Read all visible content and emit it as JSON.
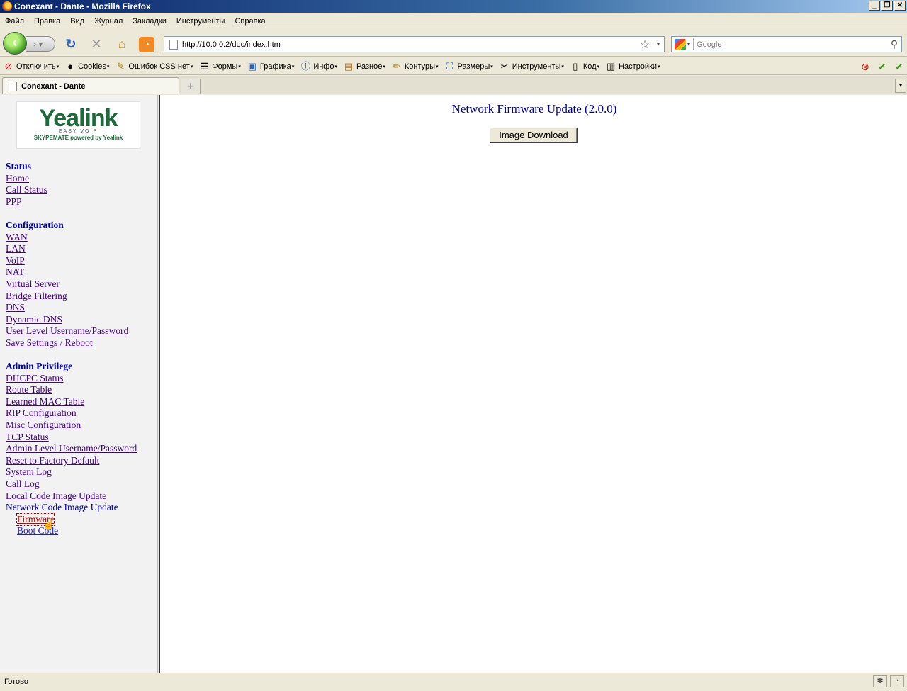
{
  "window": {
    "title": "Conexant - Dante - Mozilla Firefox",
    "buttons": [
      "_",
      "❐",
      "✕"
    ]
  },
  "menu": [
    "Файл",
    "Правка",
    "Вид",
    "Журнал",
    "Закладки",
    "Инструменты",
    "Справка"
  ],
  "navigation": {
    "url": "http://10.0.0.2/doc/index.htm",
    "search_placeholder": "Google"
  },
  "devtoolbar": {
    "items": [
      {
        "icon": "disable-icon",
        "label": "Отключить"
      },
      {
        "icon": "cookies-icon",
        "label": "Cookies"
      },
      {
        "icon": "css-icon",
        "label": "Ошибок CSS нет"
      },
      {
        "icon": "forms-icon",
        "label": "Формы"
      },
      {
        "icon": "images-icon",
        "label": "Графика"
      },
      {
        "icon": "info-icon",
        "label": "Инфо"
      },
      {
        "icon": "misc-icon",
        "label": "Разное"
      },
      {
        "icon": "outline-icon",
        "label": "Контуры"
      },
      {
        "icon": "resize-icon",
        "label": "Размеры"
      },
      {
        "icon": "tools-icon",
        "label": "Инструменты"
      },
      {
        "icon": "source-icon",
        "label": "Код"
      },
      {
        "icon": "options-icon",
        "label": "Настройки"
      }
    ]
  },
  "tabs": [
    {
      "title": "Conexant - Dante",
      "active": true
    }
  ],
  "sidebar": {
    "logo": {
      "wordmark": "Yealink",
      "subtitle": "EASY VOIP",
      "tagline": "SKYPEMATE powered by Yealink"
    },
    "status_heading": "Status",
    "status_links": [
      "Home",
      "Call Status",
      "PPP"
    ],
    "config_heading": "Configuration",
    "config_links": [
      "WAN",
      "LAN",
      "VoIP",
      "NAT",
      "Virtual Server",
      "Bridge Filtering",
      "DNS",
      "Dynamic DNS",
      "User Level Username/Password",
      "Save Settings / Reboot"
    ],
    "admin_heading": "Admin Privilege",
    "admin_links": [
      "DHCPC Status",
      "Route Table",
      "Learned MAC Table",
      "RIP Configuration",
      "Misc Configuration",
      "TCP Status",
      "Admin Level Username/Password",
      "Reset to Factory Default",
      "System Log",
      "Call Log",
      "Local Code Image Update"
    ],
    "network_update_label": "Network Code Image Update",
    "network_update_sub": [
      "Firmware",
      "Boot Code"
    ]
  },
  "main": {
    "title": "Network Firmware Update (2.0.0)",
    "download_button": "Image Download"
  },
  "status_bar": {
    "text": "Готово"
  }
}
